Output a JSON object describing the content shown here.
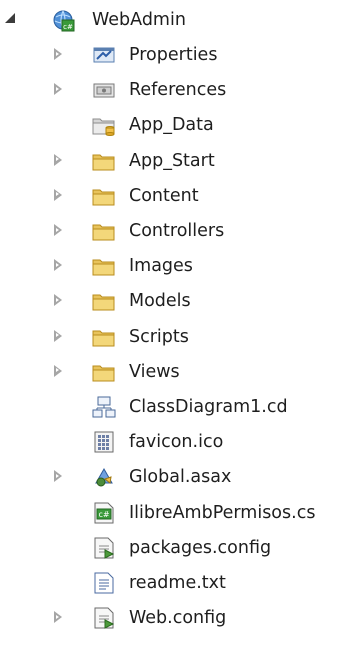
{
  "project": {
    "name": "WebAdmin",
    "icon": "csharp-web-project-icon",
    "expanded": true
  },
  "items": [
    {
      "name": "Properties",
      "icon": "properties-icon",
      "expander": "collapsed"
    },
    {
      "name": "References",
      "icon": "references-icon",
      "expander": "collapsed"
    },
    {
      "name": "App_Data",
      "icon": "special-folder-icon",
      "expander": "none"
    },
    {
      "name": "App_Start",
      "icon": "folder-icon",
      "expander": "collapsed"
    },
    {
      "name": "Content",
      "icon": "folder-icon",
      "expander": "collapsed"
    },
    {
      "name": "Controllers",
      "icon": "folder-icon",
      "expander": "collapsed"
    },
    {
      "name": "Images",
      "icon": "folder-icon",
      "expander": "collapsed"
    },
    {
      "name": "Models",
      "icon": "folder-icon",
      "expander": "collapsed"
    },
    {
      "name": "Scripts",
      "icon": "folder-icon",
      "expander": "collapsed"
    },
    {
      "name": "Views",
      "icon": "folder-icon",
      "expander": "collapsed"
    },
    {
      "name": "ClassDiagram1.cd",
      "icon": "class-diagram-icon",
      "expander": "none"
    },
    {
      "name": "favicon.ico",
      "icon": "icon-file-icon",
      "expander": "none"
    },
    {
      "name": "Global.asax",
      "icon": "global-asax-icon",
      "expander": "collapsed"
    },
    {
      "name": "IlibreAmbPermisos.cs",
      "icon": "csharp-file-icon",
      "expander": "none"
    },
    {
      "name": "packages.config",
      "icon": "config-file-icon",
      "expander": "none"
    },
    {
      "name": "readme.txt",
      "icon": "text-file-icon",
      "expander": "none"
    },
    {
      "name": "Web.config",
      "icon": "config-file-icon",
      "expander": "collapsed"
    }
  ],
  "colors": {
    "folder": "#e8c35c",
    "expander_collapsed": "#a6a6a6",
    "expander_expanded": "#3c3c3c",
    "text": "#1e1e1e"
  }
}
